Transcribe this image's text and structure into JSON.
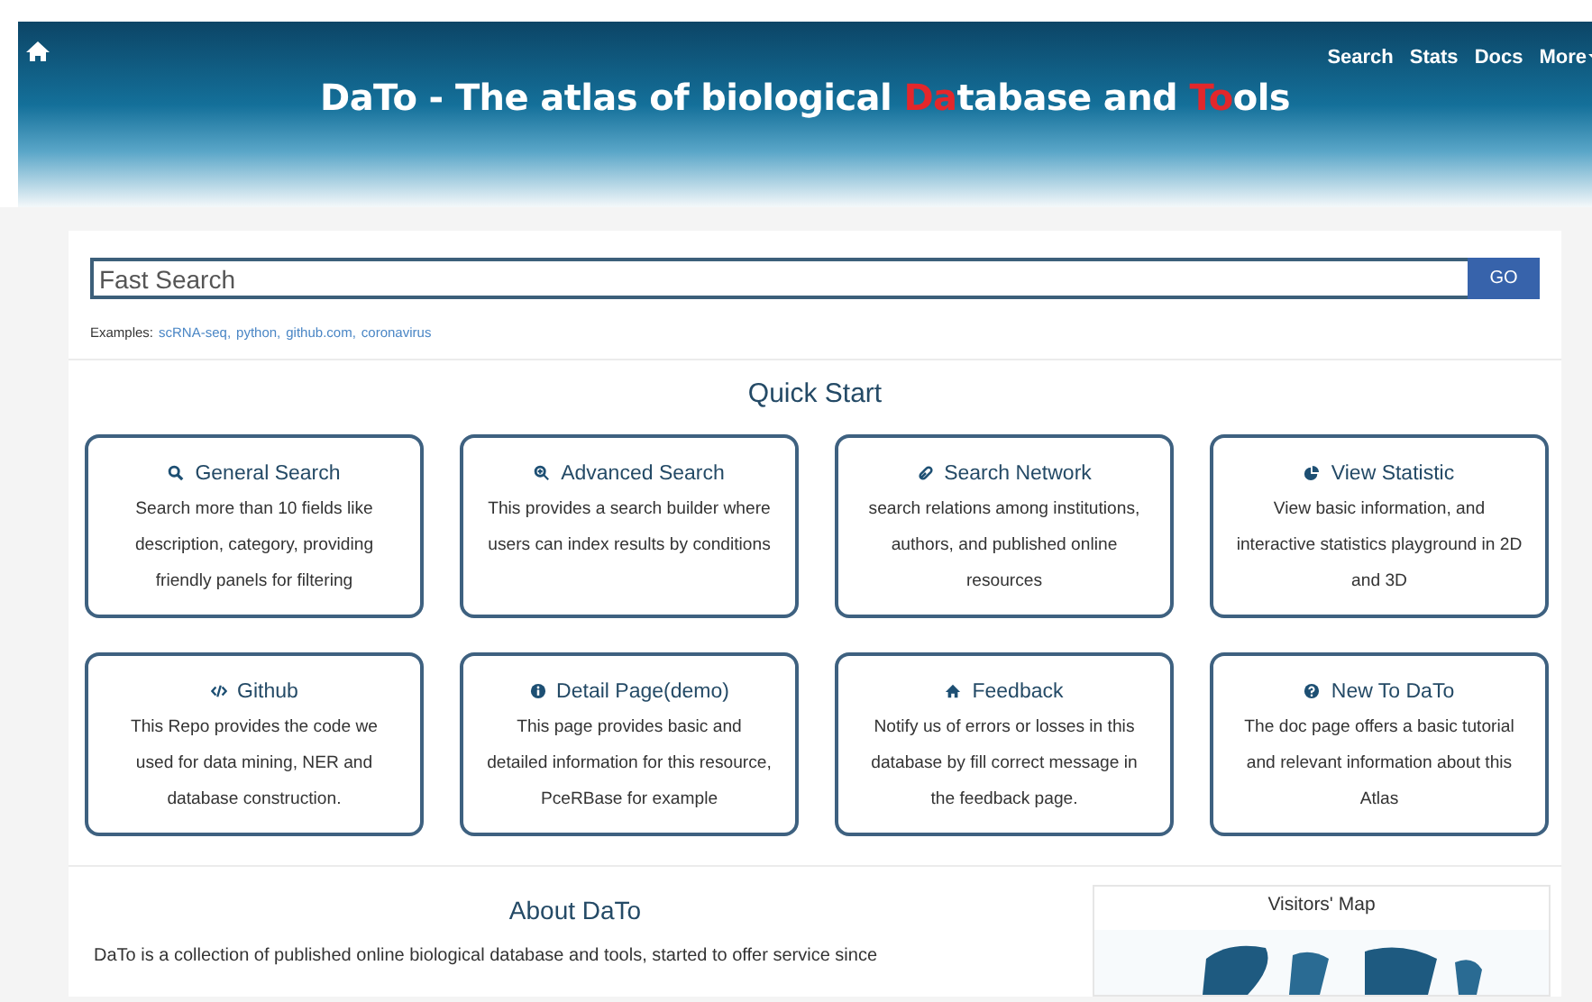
{
  "header": {
    "title_parts": [
      {
        "text": "DaTo - The atlas of biological ",
        "highlight": false
      },
      {
        "text": "Da",
        "highlight": true
      },
      {
        "text": "tabase and ",
        "highlight": false
      },
      {
        "text": "To",
        "highlight": true
      },
      {
        "text": "ols",
        "highlight": false
      }
    ],
    "nav": [
      "Search",
      "Stats",
      "Docs",
      "More"
    ]
  },
  "search": {
    "placeholder": "Fast Search",
    "button": "GO",
    "examples_label": "Examples:",
    "examples": [
      "scRNA-seq,",
      "python,",
      "github.com,",
      "coronavirus"
    ]
  },
  "quick_start": {
    "title": "Quick Start",
    "cards": [
      {
        "kind": "search",
        "title": "General Search",
        "text": "Search more than 10 fields like description, category, providing friendly panels for filtering"
      },
      {
        "kind": "zoom",
        "title": "Advanced Search",
        "text": "This provides a search builder where users can index results by conditions"
      },
      {
        "kind": "link",
        "title": "Search Network",
        "text": "search relations among institutions, authors, and published online resources"
      },
      {
        "kind": "pie",
        "title": "View Statistic",
        "text": "View basic information, and interactive statistics playground in 2D and 3D"
      },
      {
        "kind": "code",
        "title": "Github",
        "text": "This Repo provides the code we used for data mining, NER and database construction."
      },
      {
        "kind": "info",
        "title": "Detail Page(demo)",
        "text": "This page provides basic and detailed information for this resource, PceRBase for example"
      },
      {
        "kind": "home",
        "title": "Feedback",
        "text": "Notify us of errors or losses in this database by fill correct message in the feedback page."
      },
      {
        "kind": "question",
        "title": "New To DaTo",
        "text": "The doc page offers a basic tutorial and relevant information about this Atlas"
      }
    ]
  },
  "about": {
    "title": "About DaTo",
    "text": "DaTo is a collection of published online biological database and tools, started to offer service since"
  },
  "visitors_map": {
    "title": "Visitors' Map"
  }
}
